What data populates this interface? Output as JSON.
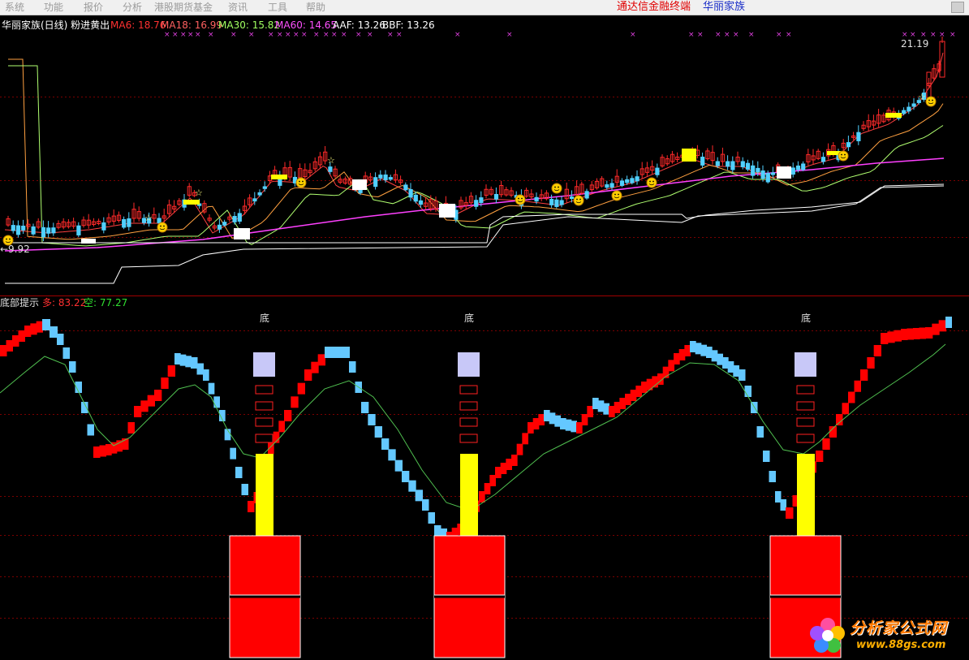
{
  "menu": [
    {
      "label": "系统",
      "name": "menu-system"
    },
    {
      "label": "功能",
      "name": "menu-function"
    },
    {
      "label": "报价",
      "name": "menu-quote"
    },
    {
      "label": "分析",
      "name": "menu-analysis"
    },
    {
      "label": "港股期货基金",
      "name": "menu-hk-futures-fund"
    },
    {
      "label": "资讯",
      "name": "menu-news"
    },
    {
      "label": "工具",
      "name": "menu-tools"
    },
    {
      "label": "帮助",
      "name": "menu-help"
    }
  ],
  "brand_center": "通达信金融终端",
  "brand_right": "华丽家族",
  "main_panel": {
    "title": "华丽家族(日线) 粉进黄出",
    "indicators": [
      {
        "label": "MA6: 18.76",
        "color": "#ff3030"
      },
      {
        "label": "MA18: 16.99",
        "color": "#ff6060"
      },
      {
        "label": "MA30: 15.82",
        "color": "#a0ff60"
      },
      {
        "label": "MA60: 14.65",
        "color": "#ff50ff"
      },
      {
        "label": "AAF: 13.26",
        "color": "#ffffff"
      },
      {
        "label": "BBF: 13.26",
        "color": "#ffffff"
      }
    ],
    "high_label": "21.19",
    "low_label": "9.92"
  },
  "sub_panel": {
    "title": "底部提示",
    "duo_label": "多: 83.22",
    "kong_label": "空: 77.27",
    "bottom_marker": "底",
    "bottom_markers": [
      {
        "text": "底"
      },
      {
        "text": "底"
      },
      {
        "text": "底"
      }
    ]
  },
  "colors": {
    "background": "#000000",
    "up_candle": "#ff2020",
    "down_candle": "#50d0ff",
    "buy_bar": "#ff0000",
    "sell_bar": "#60c8ff",
    "signal_yellow": "#ffff00",
    "grid": "#8b0000"
  },
  "watermark": {
    "text": "分析家公式网",
    "url": "www.88gs.com"
  }
}
